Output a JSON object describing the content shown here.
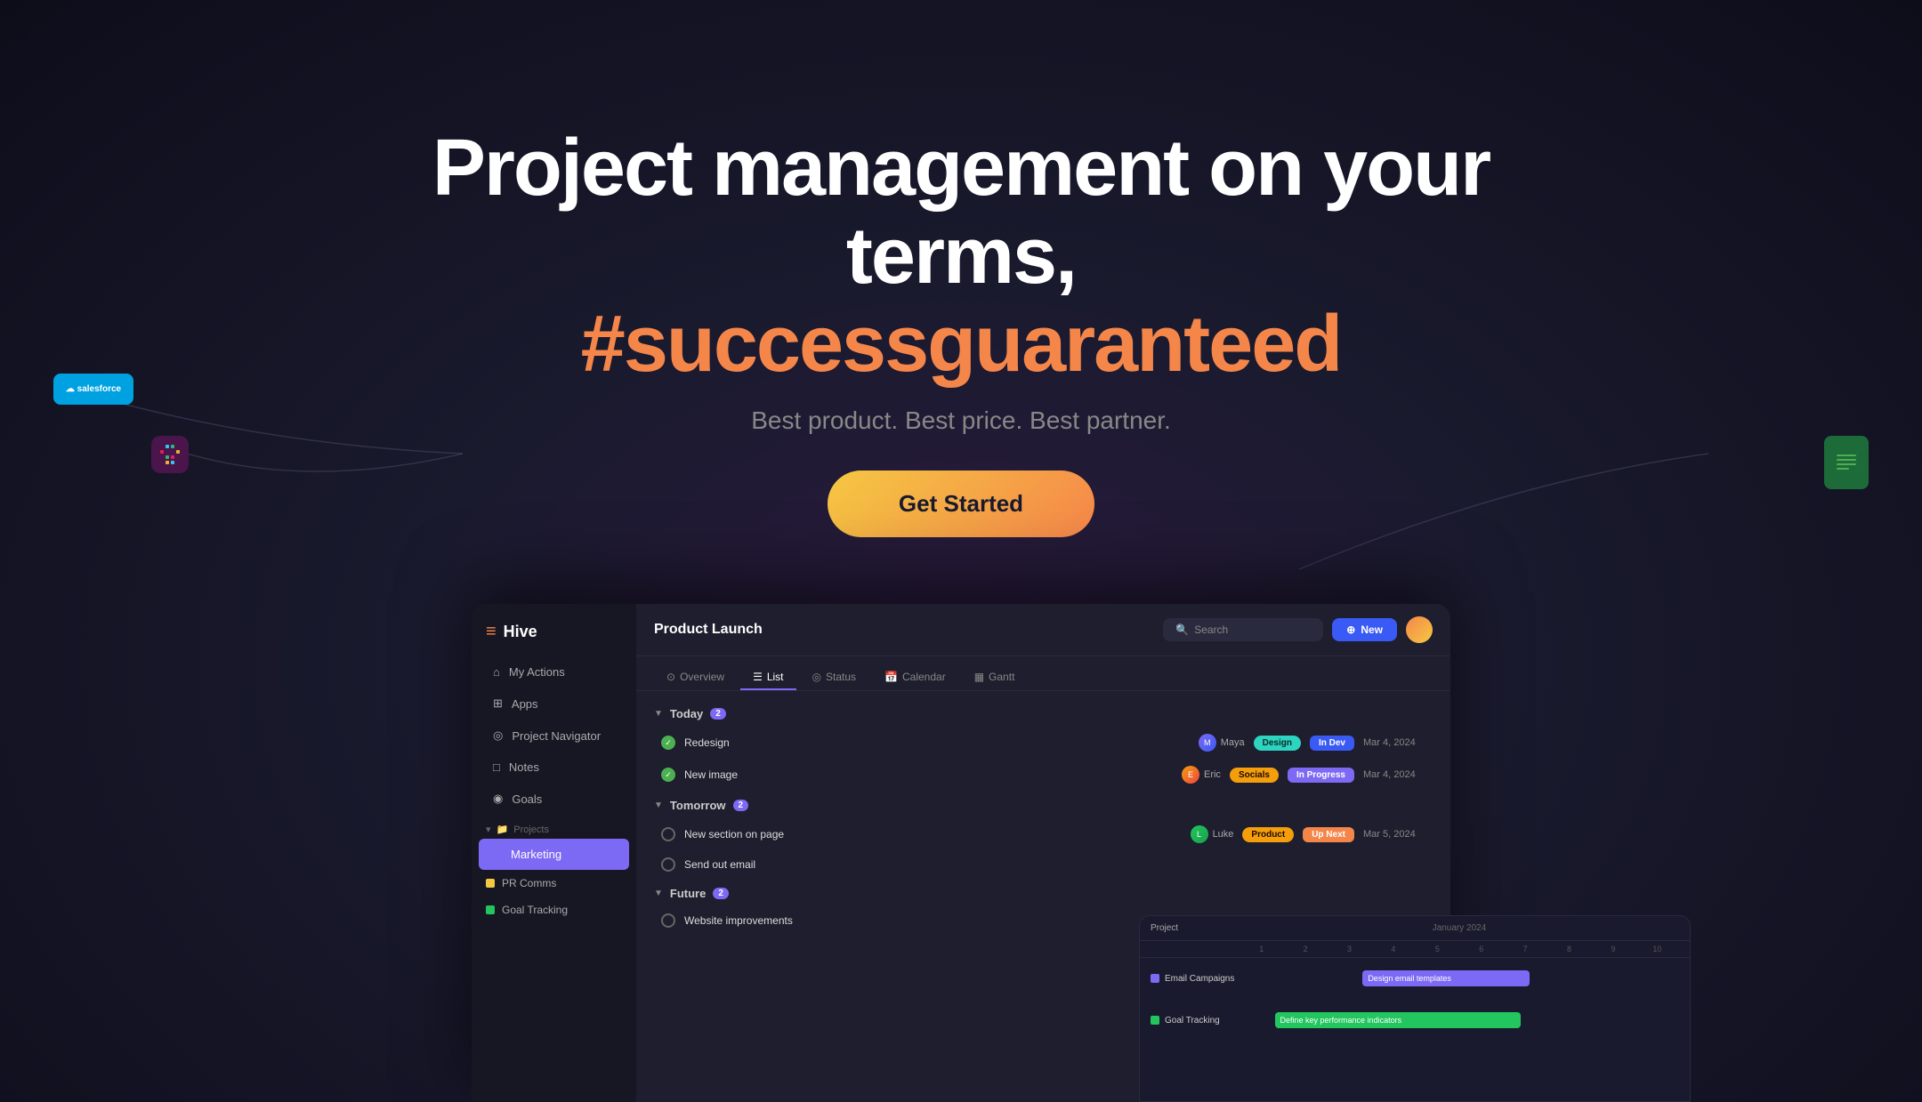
{
  "meta": {
    "title": "Hive - Project management on your terms"
  },
  "hero": {
    "line1": "Project management on your terms,",
    "line2": "#successguaranteed",
    "subtitle": "Best product. Best price. Best partner.",
    "cta": "Get Started"
  },
  "integrations": {
    "salesforce": "salesforce",
    "slack": "S",
    "sheets": "≡"
  },
  "sidebar": {
    "logo": "Hive",
    "nav_items": [
      {
        "label": "My Actions",
        "icon": "home"
      },
      {
        "label": "Apps",
        "icon": "grid"
      },
      {
        "label": "Project Navigator",
        "icon": "compass"
      },
      {
        "label": "Notes",
        "icon": "file"
      },
      {
        "label": "Goals",
        "icon": "target"
      }
    ],
    "projects_section": "Projects",
    "projects": [
      {
        "label": "Marketing",
        "color": "#7c6af5",
        "active": true
      },
      {
        "label": "PR Comms",
        "color": "#f5c842",
        "active": false
      },
      {
        "label": "Goal Tracking",
        "color": "#22c55e",
        "active": false
      }
    ]
  },
  "header": {
    "project_title": "Product Launch",
    "search_placeholder": "Search",
    "new_button": "New"
  },
  "tabs": [
    {
      "label": "Overview",
      "icon": "⊙",
      "active": false
    },
    {
      "label": "List",
      "icon": "☰",
      "active": true
    },
    {
      "label": "Status",
      "icon": "◎",
      "active": false
    },
    {
      "label": "Calendar",
      "icon": "📅",
      "active": false
    },
    {
      "label": "Gantt",
      "icon": "▦",
      "active": false
    }
  ],
  "sections": [
    {
      "title": "Today",
      "count": 2,
      "tasks": [
        {
          "name": "Redesign",
          "assignee": "Maya",
          "tag": "Design",
          "tag_class": "tag-design",
          "status": "In Dev",
          "status_class": "status-indev",
          "date": "Mar 4, 2024",
          "completed": true
        },
        {
          "name": "New image",
          "assignee": "Eric",
          "tag": "Socials",
          "tag_class": "tag-socials",
          "status": "In Progress",
          "status_class": "status-inprogress",
          "date": "Mar 4, 2024",
          "completed": true
        }
      ]
    },
    {
      "title": "Tomorrow",
      "count": 2,
      "tasks": [
        {
          "name": "New section on page",
          "assignee": "Luke",
          "tag": "Product",
          "tag_class": "tag-product",
          "status": "Up Next",
          "status_class": "status-upnext",
          "date": "Mar 5, 2024",
          "completed": false
        },
        {
          "name": "Send out email",
          "assignee": "",
          "tag": "",
          "tag_class": "",
          "status": "",
          "status_class": "",
          "date": "",
          "completed": false
        }
      ]
    },
    {
      "title": "Future",
      "count": 2,
      "tasks": [
        {
          "name": "Website improvements",
          "assignee": "",
          "tag": "",
          "tag_class": "",
          "status": "",
          "status_class": "",
          "date": "",
          "completed": false
        }
      ]
    }
  ],
  "gantt": {
    "title": "January 2024",
    "columns": [
      "1",
      "2",
      "3",
      "4",
      "5",
      "6",
      "7",
      "8",
      "9",
      "10"
    ],
    "project_col": "Project",
    "rows": [
      {
        "label": "Email Campaigns",
        "color": "#7c6af5",
        "bar_label": "Design email templates",
        "bar_class": "bar-purple bar-email"
      },
      {
        "label": "Goal Tracking",
        "color": "#22c55e",
        "bar_label": "Define key performance indicators",
        "bar_class": "bar-green bar-goal"
      }
    ]
  }
}
